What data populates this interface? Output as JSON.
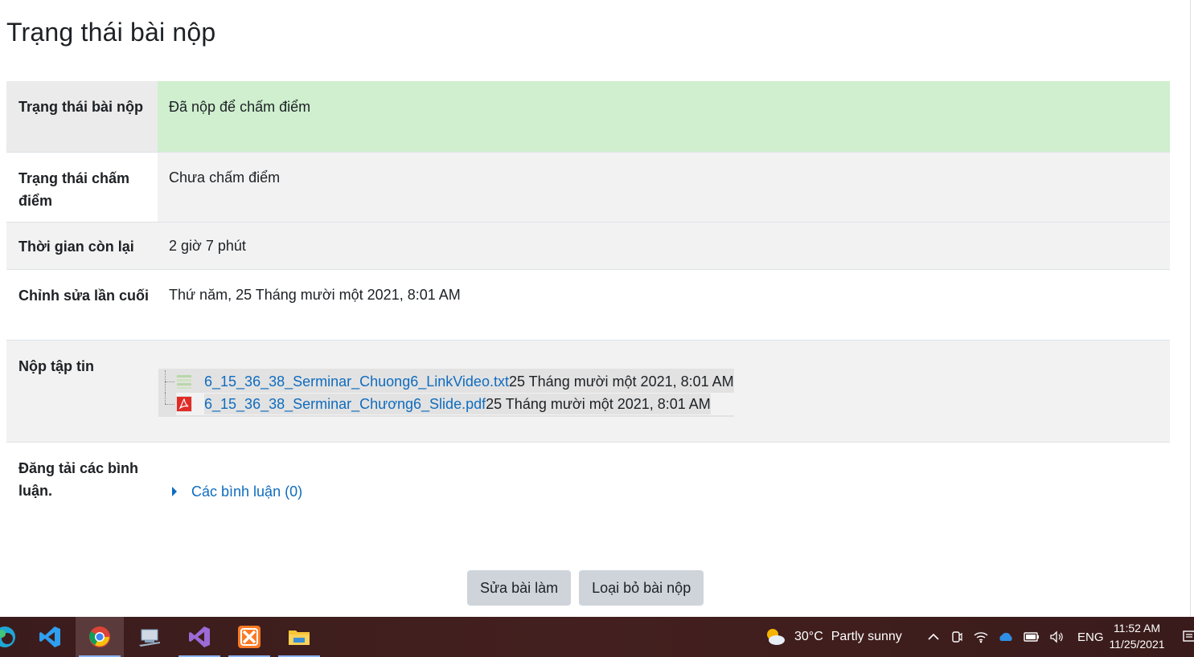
{
  "page": {
    "title": "Trạng thái bài nộp"
  },
  "status_table": {
    "rows": {
      "submission_status": {
        "label": "Trạng thái bài nộp",
        "value": "Đã nộp để chấm điểm"
      },
      "grading_status": {
        "label": "Trạng thái chấm điểm",
        "value": "Chưa chấm điểm"
      },
      "time_remaining": {
        "label": "Thời gian còn lại",
        "value": "2 giờ 7 phút"
      },
      "last_modified": {
        "label": "Chỉnh sửa lần cuối",
        "value": "Thứ năm, 25 Tháng mười một 2021, 8:01 AM"
      },
      "file_submissions": {
        "label": "Nộp tập tin",
        "files": [
          {
            "name": "6_15_36_38_Serminar_Chuong6_LinkVideo.txt",
            "date": "25 Tháng mười một 2021, 8:01 AM",
            "icon": "text-file-icon"
          },
          {
            "name": "6_15_36_38_Serminar_Chương6_Slide.pdf",
            "date": "25 Tháng mười một 2021, 8:01 AM",
            "icon": "pdf-file-icon"
          }
        ]
      },
      "comments": {
        "label": "Đăng tải các bình luận.",
        "link": "Các bình luận (0)"
      }
    }
  },
  "buttons": {
    "edit": "Sửa bài làm",
    "remove": "Loại bỏ bài nộp"
  },
  "taskbar": {
    "apps": [
      "edge-icon",
      "vscode-icon",
      "chrome-icon",
      "remote-desktop-icon",
      "visual-studio-icon",
      "xampp-icon",
      "file-explorer-icon"
    ],
    "weather": {
      "temp": "30°C",
      "condition": "Partly sunny"
    },
    "language": "ENG",
    "time": "11:52 AM",
    "date": "11/25/2021"
  }
}
